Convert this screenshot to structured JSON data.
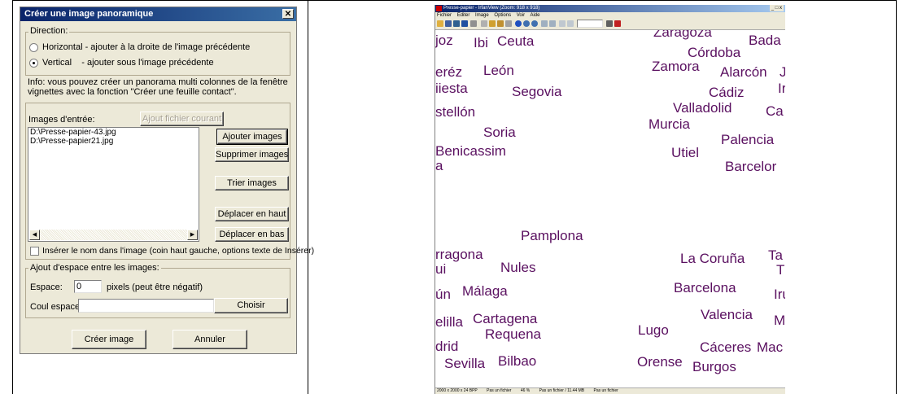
{
  "dialog": {
    "title": "Créer une image panoramique",
    "direction": {
      "legend": "Direction:",
      "horizontal_label": "Horizontal - ajouter à la droite de l'image précédente",
      "vertical_label": "Vertical    - ajouter sous l'image précédente",
      "selected": "vertical"
    },
    "info_text": "Info: vous pouvez créer un panorama multi colonnes de la fenêtre vignettes avec la fonction \"Créer une feuille contact\".",
    "input_images": {
      "label": "Images d'entrée:",
      "add_current_button": "Ajout fichier courant",
      "files": [
        "D:\\Presse-papier-43.jpg",
        "D:\\Presse-papier21.jpg"
      ],
      "add_images_button": "Ajouter images",
      "remove_images_button": "Supprimer images",
      "sort_images_button": "Trier images",
      "move_up_button": "Déplacer en haut",
      "move_down_button": "Déplacer en bas"
    },
    "insert_name_label": "Insérer le nom dans l'image (coin haut gauche, options texte de Insérer)",
    "spacing": {
      "legend": "Ajout d'espace entre les images:",
      "space_label": "Espace:",
      "space_value": "0",
      "space_unit": "pixels (peut être négatif)",
      "color_label": "Coul espace",
      "color_value": "",
      "choose_button": "Choisir"
    },
    "create_button": "Créer image",
    "cancel_button": "Annuler"
  },
  "viewer": {
    "title": "Presse-papier - IrfanView (Zoom: 918 x 918)",
    "window_controls": "_ □ x",
    "menu": [
      "Fichier",
      "Editer",
      "Image",
      "Options",
      "Voir",
      "Aide"
    ],
    "cities": [
      "Zaragoza",
      "Bada",
      "Ceuta",
      "Ibi",
      "joz",
      "Córdoba",
      "Zamora",
      "Alarcón",
      "J",
      "eréz",
      "León",
      "iiesta",
      "Segovia",
      "Cádiz",
      "Ir",
      "stellón",
      "Valladolid",
      "Ca",
      "Murcia",
      "Soria",
      "Palencia",
      "Benicassim",
      "Utiel",
      "Barcelor",
      "a",
      "Pamplona",
      "rragona",
      "La Coruña",
      "Ta",
      "ui",
      "Nules",
      "T",
      "ún",
      "Málaga",
      "Barcelona",
      "Iru",
      "Valencia",
      "elilla",
      "Cartagena",
      "M",
      "Lugo",
      "Requena",
      "drid",
      "Cáceres",
      "Mac",
      "Sevilla",
      "Bilbao",
      "Orense",
      "Burgos"
    ],
    "status": [
      "2000 x 2000 x 24 BPP",
      "Pas un fichier",
      "46 %",
      "Pas un fichier / 11.44 MB",
      "Pas un fichier"
    ],
    "text_color": "#5a1060"
  }
}
